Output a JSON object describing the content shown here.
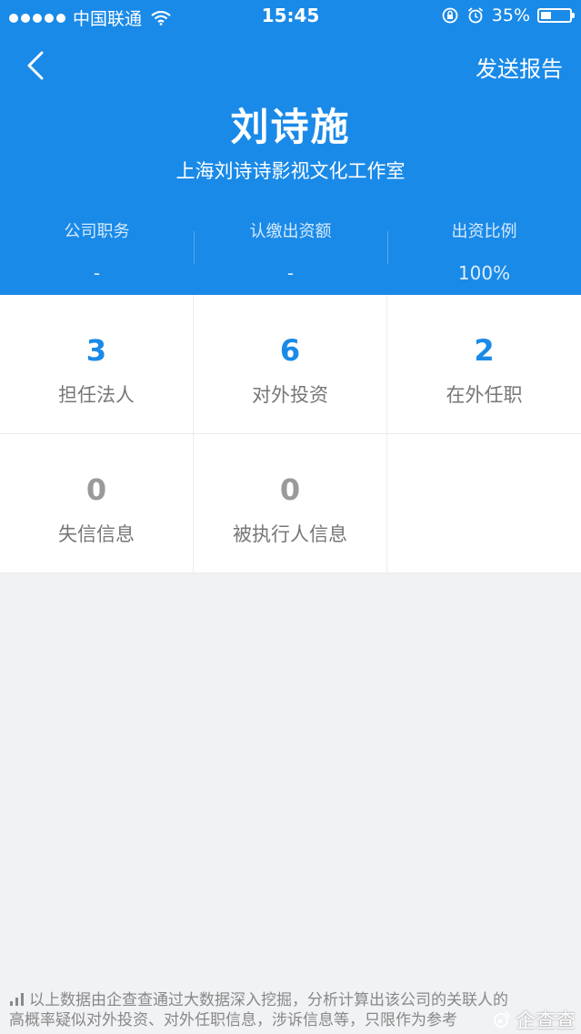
{
  "status_bar": {
    "carrier": "中国联通",
    "time": "15:45",
    "battery": "35%",
    "battery_level": 0.35
  },
  "nav": {
    "send_report": "发送报告"
  },
  "person": {
    "name": "刘诗施",
    "company": "上海刘诗诗影视文化工作室"
  },
  "info": [
    {
      "label": "公司职务",
      "value": "-"
    },
    {
      "label": "认缴出资额",
      "value": "-"
    },
    {
      "label": "出资比例",
      "value": "100%"
    }
  ],
  "stats": [
    {
      "value": "3",
      "label": "担任法人"
    },
    {
      "value": "6",
      "label": "对外投资"
    },
    {
      "value": "2",
      "label": "在外任职"
    },
    {
      "value": "0",
      "label": "失信信息"
    },
    {
      "value": "0",
      "label": "被执行人信息"
    }
  ],
  "footer": {
    "line1": "以上数据由企查查通过大数据深入挖掘，分析计算出该公司的关联人的",
    "line2": "高概率疑似对外投资、对外任职信息，涉诉信息等，只限作为参考"
  },
  "watermark": "企查查",
  "colors": {
    "header": "#1a8ae8",
    "accent_blue": "#1a8ae8",
    "zero_gray": "#9a9a9a",
    "background": "#f1f2f4"
  }
}
